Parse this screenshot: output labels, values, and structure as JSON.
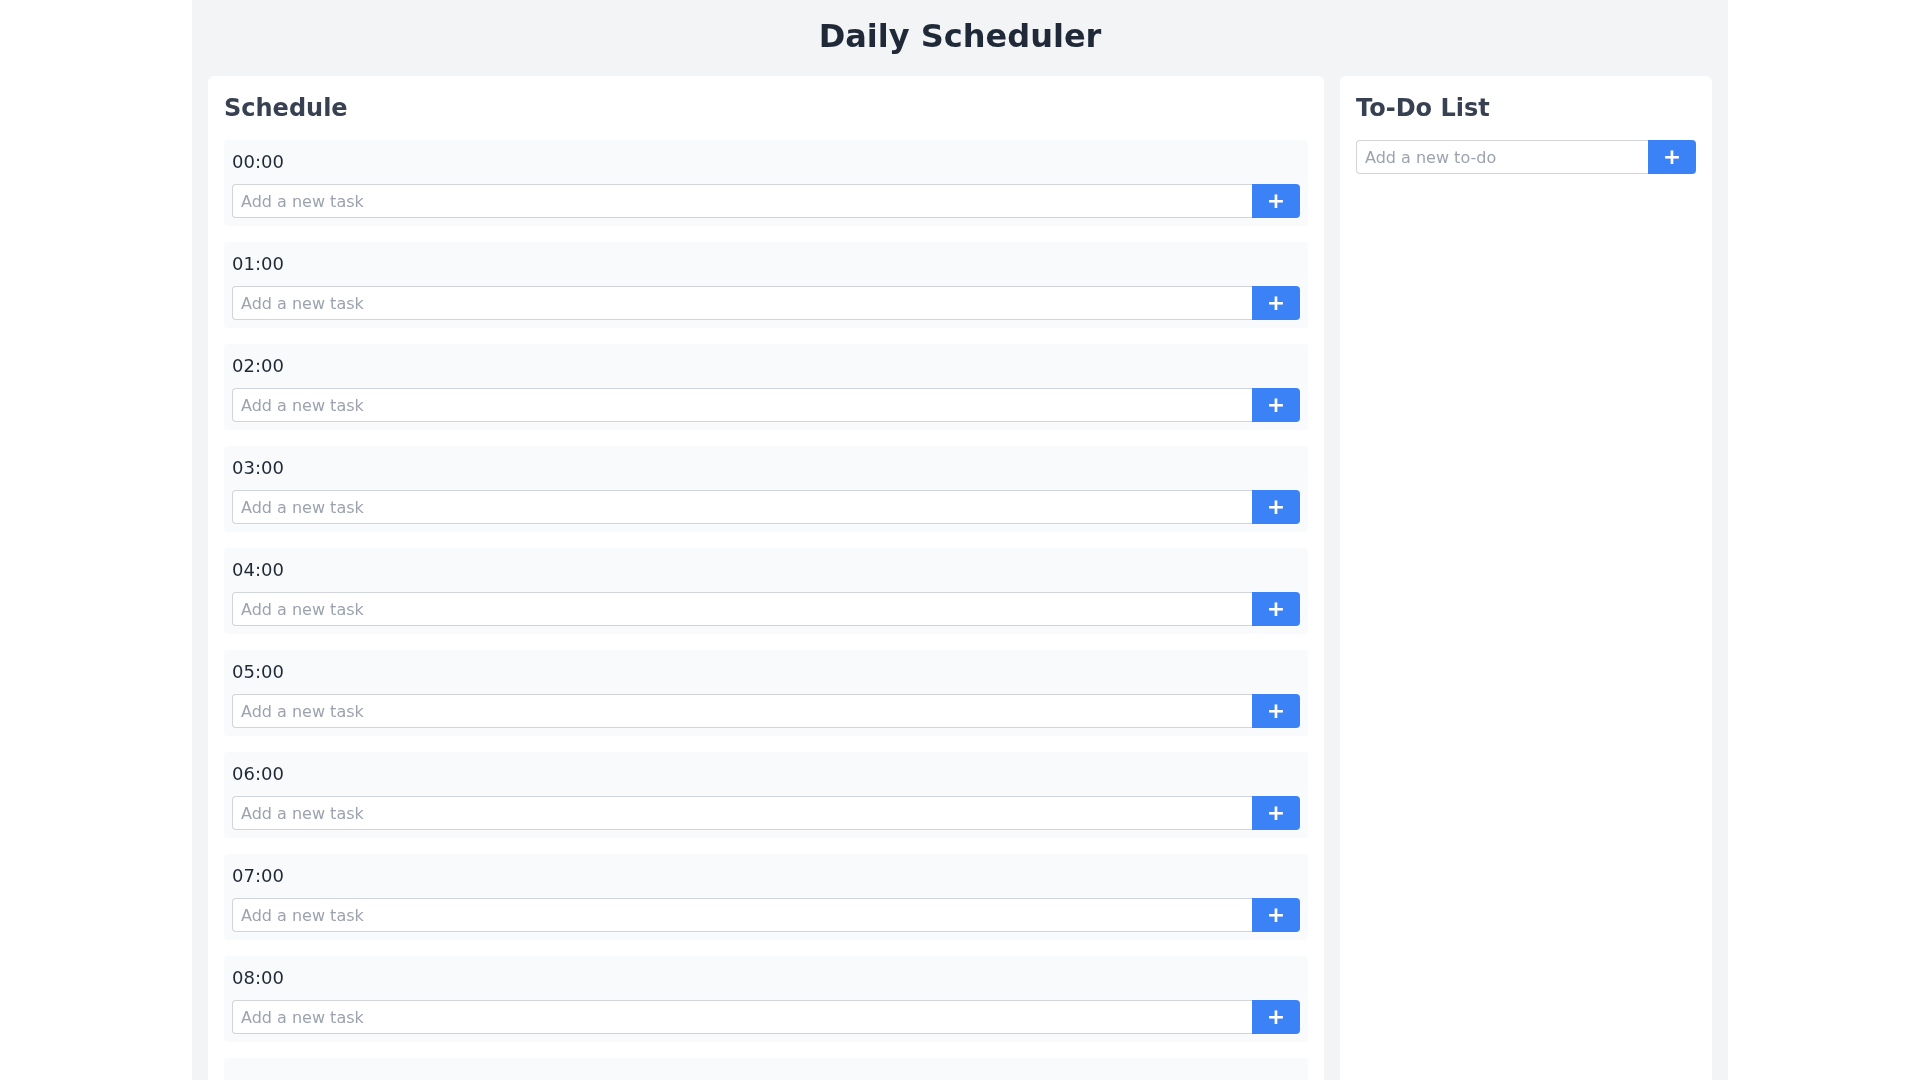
{
  "title": "Daily Scheduler",
  "schedule": {
    "heading": "Schedule",
    "slots": [
      {
        "time": "00:00",
        "placeholder": "Add a new task",
        "button": "+"
      },
      {
        "time": "01:00",
        "placeholder": "Add a new task",
        "button": "+"
      },
      {
        "time": "02:00",
        "placeholder": "Add a new task",
        "button": "+"
      },
      {
        "time": "03:00",
        "placeholder": "Add a new task",
        "button": "+"
      },
      {
        "time": "04:00",
        "placeholder": "Add a new task",
        "button": "+"
      },
      {
        "time": "05:00",
        "placeholder": "Add a new task",
        "button": "+"
      },
      {
        "time": "06:00",
        "placeholder": "Add a new task",
        "button": "+"
      },
      {
        "time": "07:00",
        "placeholder": "Add a new task",
        "button": "+"
      },
      {
        "time": "08:00",
        "placeholder": "Add a new task",
        "button": "+"
      }
    ]
  },
  "todo": {
    "heading": "To-Do List",
    "placeholder": "Add a new to-do",
    "button": "+"
  }
}
